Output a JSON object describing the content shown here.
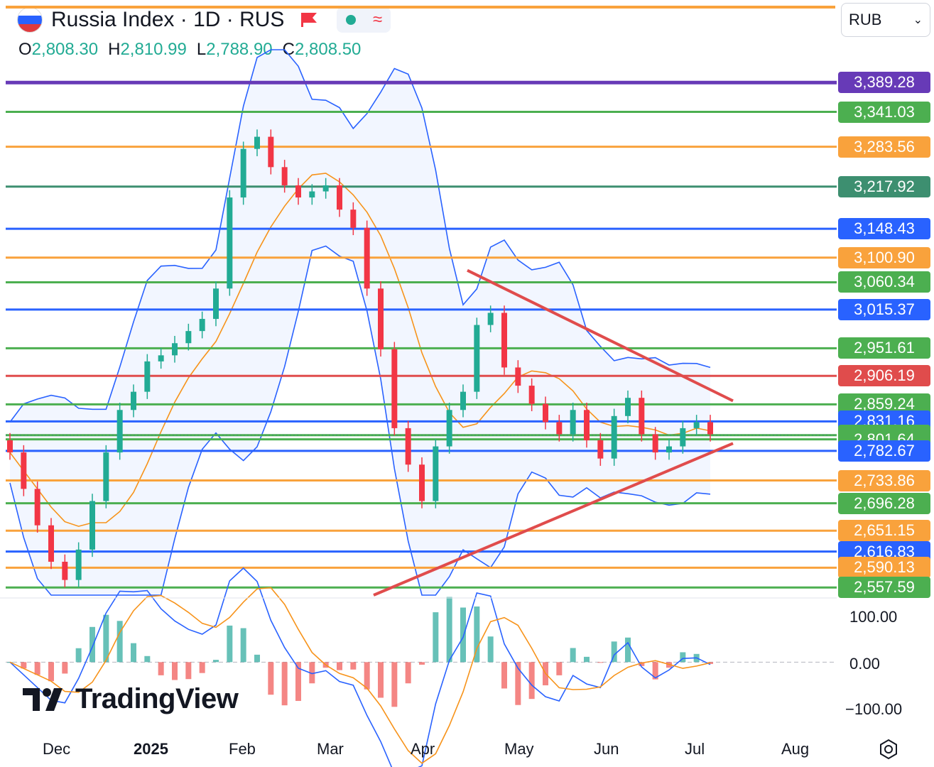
{
  "header": {
    "symbol_title": "Russia Index · 1D · RUS",
    "ohlc": [
      {
        "key": "O",
        "value": "2,808.30"
      },
      {
        "key": "H",
        "value": "2,810.99"
      },
      {
        "key": "L",
        "value": "2,788.90"
      },
      {
        "key": "C",
        "value": "2,808.50"
      }
    ],
    "currency": "RUB"
  },
  "icons": {
    "flag": "russia-flag-icon",
    "flag_marker": "red-flag-icon",
    "status": "green-dot-icon",
    "wave": "wave-icon",
    "settings": "settings-icon",
    "dropdown": "chevron-down-icon",
    "logo": "tradingview-logo"
  },
  "colors": {
    "up": "#22ab94",
    "down": "#f23645",
    "bb": "#2962ff",
    "ma": "#f7931a",
    "green": "#4caf50",
    "orange": "#f9a23c",
    "blue": "#2962ff",
    "purple": "#673ab7",
    "red": "#e04c4c",
    "teal": "#3d8f70"
  },
  "chart_data": {
    "type": "candlestick",
    "price_axis": {
      "min": 2545,
      "max": 3420
    },
    "time_axis": [
      "Dec",
      "2025",
      "Feb",
      "Mar",
      "Apr",
      "May",
      "Jun",
      "Jul",
      "Aug"
    ],
    "last_price": 2808.5,
    "levels": [
      {
        "price": 3389.28,
        "label": "3,389.28",
        "color": "#673ab7"
      },
      {
        "price": 3341.03,
        "label": "3,341.03",
        "color": "#4caf50"
      },
      {
        "price": 3283.56,
        "label": "3,283.56",
        "color": "#f9a23c"
      },
      {
        "price": 3217.92,
        "label": "3,217.92",
        "color": "#3d8f70"
      },
      {
        "price": 3148.43,
        "label": "3,148.43",
        "color": "#2962ff"
      },
      {
        "price": 3100.9,
        "label": "3,100.90",
        "color": "#f9a23c"
      },
      {
        "price": 3060.34,
        "label": "3,060.34",
        "color": "#4caf50"
      },
      {
        "price": 3015.37,
        "label": "3,015.37",
        "color": "#2962ff"
      },
      {
        "price": 2951.61,
        "label": "2,951.61",
        "color": "#4caf50"
      },
      {
        "price": 2906.19,
        "label": "2,906.19",
        "color": "#e04c4c"
      },
      {
        "price": 2859.24,
        "label": "2,859.24",
        "color": "#4caf50"
      },
      {
        "price": 2831.16,
        "label": "2,831.16",
        "color": "#2962ff"
      },
      {
        "price": 2808.5,
        "label": "2,808.50",
        "color": "#4caf50"
      },
      {
        "price": 2801.64,
        "label": "2,801.64",
        "color": "#4caf50"
      },
      {
        "price": 2782.67,
        "label": "2,782.67",
        "color": "#2962ff"
      },
      {
        "price": 2733.86,
        "label": "2,733.86",
        "color": "#f9a23c"
      },
      {
        "price": 2696.28,
        "label": "2,696.28",
        "color": "#4caf50"
      },
      {
        "price": 2651.15,
        "label": "2,651.15",
        "color": "#f9a23c"
      },
      {
        "price": 2616.83,
        "label": "2,616.83",
        "color": "#2962ff"
      },
      {
        "price": 2590.13,
        "label": "2,590.13",
        "color": "#f9a23c"
      },
      {
        "price": 2557.59,
        "label": "2,557.59",
        "color": "#4caf50"
      }
    ],
    "trendlines": [
      {
        "name": "resistance",
        "from": [
          "Apr",
          3080
        ],
        "to": [
          "Jul",
          2865
        ]
      },
      {
        "name": "support",
        "from": [
          "Mar",
          2545
        ],
        "to": [
          "Jul",
          2795
        ]
      }
    ],
    "close_path": [
      2780,
      2720,
      2660,
      2600,
      2570,
      2620,
      2700,
      2780,
      2850,
      2880,
      2930,
      2940,
      2960,
      2980,
      3000,
      3050,
      3200,
      3280,
      3300,
      3250,
      3220,
      3200,
      3210,
      3220,
      3180,
      3150,
      3050,
      2950,
      2820,
      2760,
      2700,
      2790,
      2850,
      2880,
      2990,
      3010,
      2920,
      2890,
      2860,
      2830,
      2810,
      2850,
      2800,
      2770,
      2840,
      2870,
      2810,
      2780,
      2790,
      2820,
      2830,
      2810
    ]
  },
  "macd": {
    "axis_labels": [
      "100.00",
      "0.00",
      "−100.00"
    ],
    "zero": 0,
    "range": [
      -120,
      130
    ]
  },
  "price_axis_labels": [
    "3,389.28",
    "3,341.03",
    "3,283.56",
    "3,217.92",
    "3,148.43",
    "3,100.90",
    "3,060.34",
    "3,015.37",
    "2,951.61",
    "2,906.19",
    "2,859.24",
    "2,831.16",
    "2,808.50",
    "2,801.64",
    "2,782.67",
    "2,733.86",
    "2,696.28",
    "2,651.15",
    "2,616.83",
    "2,590.13",
    "2,557.59"
  ],
  "brand": {
    "name": "TradingView"
  }
}
